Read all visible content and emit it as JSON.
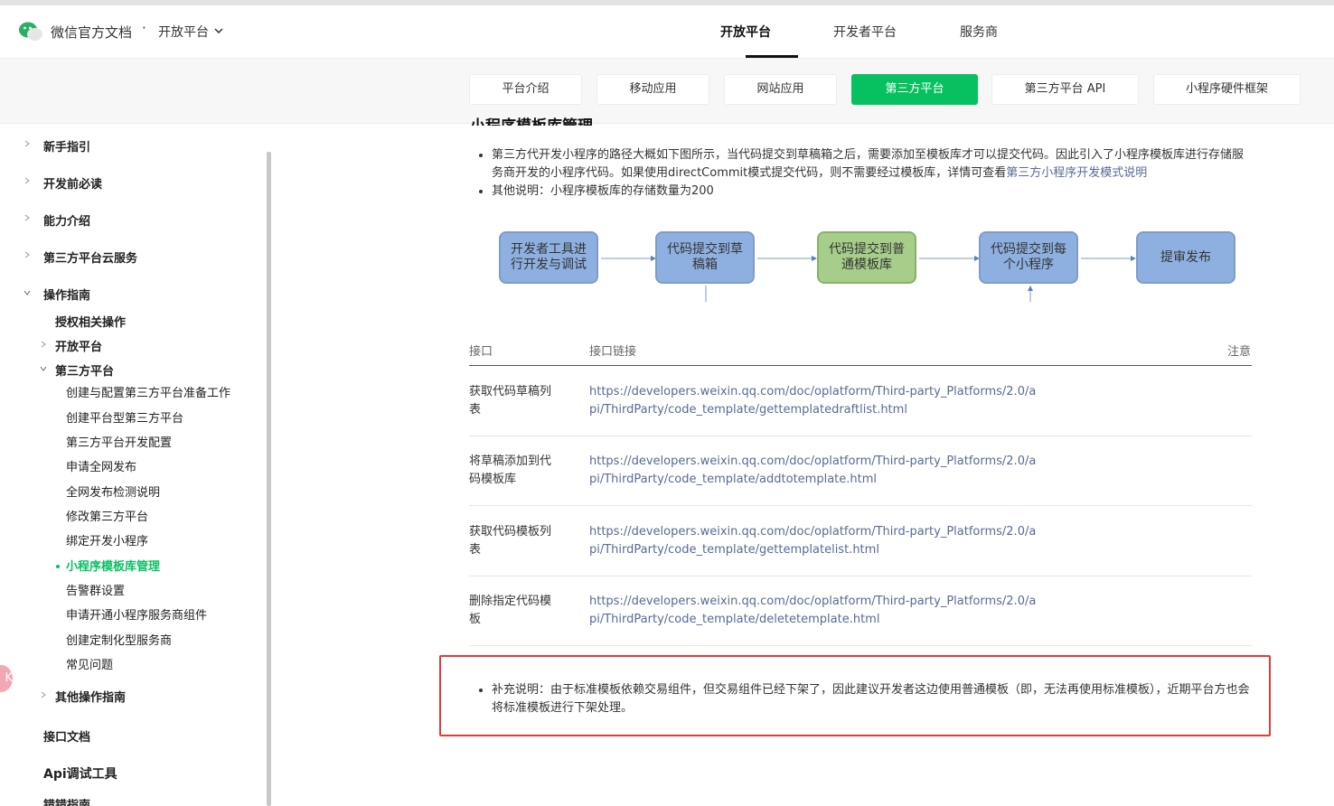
{
  "header": {
    "brand": "微信官方文档",
    "brand_separator": "·",
    "product": "开放平台",
    "nav": [
      "开放平台",
      "开发者平台",
      "服务商"
    ],
    "active_nav": "开放平台"
  },
  "subnav": {
    "tabs": [
      "平台介绍",
      "移动应用",
      "网站应用",
      "第三方平台",
      "第三方平台 API",
      "小程序硬件框架"
    ],
    "active": "第三方平台"
  },
  "sidebar": {
    "sections": [
      {
        "label": "新手指引"
      },
      {
        "label": "开发前必读"
      },
      {
        "label": "能力介绍"
      },
      {
        "label": "第三方平台云服务"
      },
      {
        "label": "操作指南"
      }
    ],
    "guide_children": {
      "auth": "授权相关操作",
      "open_platform": "开放平台",
      "third_party": "第三方平台",
      "third_party_items": [
        "创建与配置第三方平台准备工作",
        "创建平台型第三方平台",
        "第三方平台开发配置",
        "申请全网发布",
        "全网发布检测说明",
        "修改第三方平台",
        "绑定开发小程序",
        "小程序模板库管理",
        "告警群设置",
        "申请开通小程序服务商组件",
        "创建定制化型服务商",
        "常见问题"
      ],
      "active_item": "小程序模板库管理",
      "other": "其他操作指南"
    },
    "bottom": [
      "接口文档",
      "Api调试工具",
      "错错指南"
    ],
    "badge": "K"
  },
  "main": {
    "title_partial": "小程序模板库管理",
    "bullets": [
      {
        "text": "第三方代开发小程序的路径大概如下图所示，当代码提交到草稿箱之后，需要添加至模板库才可以提交代码。因此引入了小程序模板库进行存储服务商开发的小程序代码。如果使用directCommit模式提交代码，则不需要经过模板库，详情可查看",
        "link": "第三方小程序开发模式说明"
      },
      {
        "text": "其他说明：小程序模板库的存储数量为200"
      }
    ],
    "flow": [
      "开发者工具进行开发与调试",
      "代码提交到草稿箱",
      "代码提交到普通模板库",
      "代码提交到每个小程序",
      "提审发布"
    ],
    "table": {
      "headers": [
        "接口",
        "接口链接",
        "注意"
      ],
      "rows": [
        {
          "name": "获取代码草稿列表",
          "url": "https://developers.weixin.qq.com/doc/oplatform/Third-party_Platforms/2.0/api/ThirdParty/code_template/gettemplatedraftlist.html"
        },
        {
          "name": "将草稿添加到代码模板库",
          "url": "https://developers.weixin.qq.com/doc/oplatform/Third-party_Platforms/2.0/api/ThirdParty/code_template/addtotemplate.html"
        },
        {
          "name": "获取代码模板列表",
          "url": "https://developers.weixin.qq.com/doc/oplatform/Third-party_Platforms/2.0/api/ThirdParty/code_template/gettemplatelist.html"
        },
        {
          "name": "删除指定代码模板",
          "url": "https://developers.weixin.qq.com/doc/oplatform/Third-party_Platforms/2.0/api/ThirdParty/code_template/deletetemplate.html"
        }
      ]
    },
    "note": "补充说明：由于标准模板依赖交易组件，但交易组件已经下架了，因此建议开发者这边使用普通模板（即，无法再使用标准模板），近期平台方也会将标准模板进行下架处理。"
  },
  "colors": {
    "accent": "#07c160",
    "link": "#576b95",
    "highlight_border": "#e03c3c",
    "flow_blue": "#8eb0e1",
    "flow_green": "#a6cd8a"
  }
}
